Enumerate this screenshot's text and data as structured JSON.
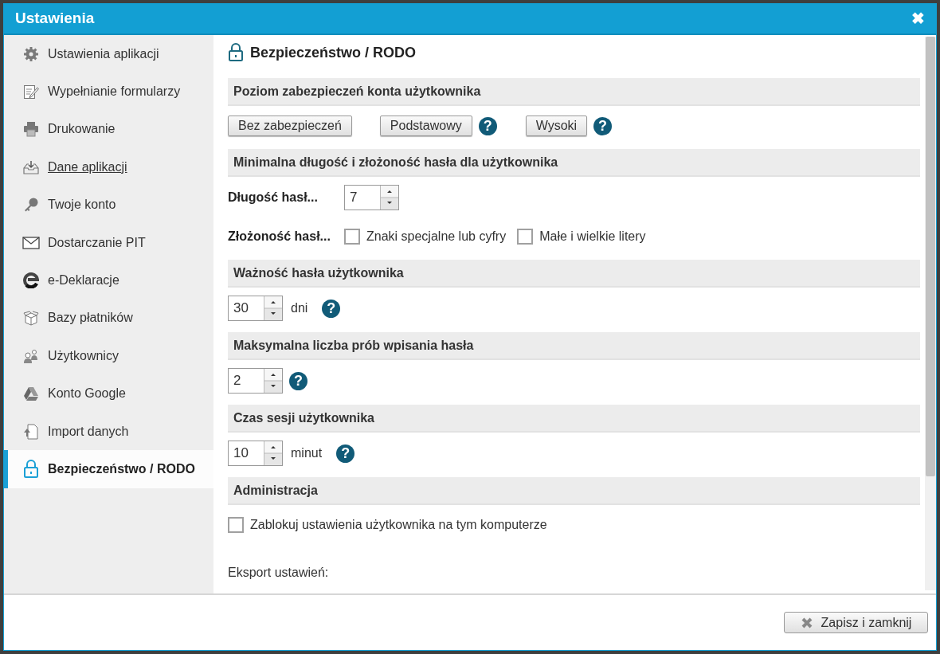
{
  "window": {
    "title": "Ustawienia",
    "close": "✖"
  },
  "sidebar": {
    "items": [
      {
        "label": "Ustawienia aplikacji",
        "selected": false,
        "hovered": false
      },
      {
        "label": "Wypełnianie formularzy",
        "selected": false,
        "hovered": false
      },
      {
        "label": "Drukowanie",
        "selected": false,
        "hovered": false
      },
      {
        "label": "Dane aplikacji",
        "selected": false,
        "hovered": true
      },
      {
        "label": "Twoje konto",
        "selected": false,
        "hovered": false
      },
      {
        "label": "Dostarczanie PIT",
        "selected": false,
        "hovered": false
      },
      {
        "label": "e-Deklaracje",
        "selected": false,
        "hovered": false
      },
      {
        "label": "Bazy płatników",
        "selected": false,
        "hovered": false
      },
      {
        "label": "Użytkownicy",
        "selected": false,
        "hovered": false
      },
      {
        "label": "Konto Google",
        "selected": false,
        "hovered": false
      },
      {
        "label": "Import danych",
        "selected": false,
        "hovered": false
      },
      {
        "label": "Bezpieczeństwo / RODO",
        "selected": true,
        "hovered": false
      }
    ]
  },
  "content": {
    "title": "Bezpieczeństwo / RODO",
    "sections": [
      {
        "heading": "Poziom zabezpieczeń konta użytkownika",
        "rows": [
          [
            {
              "kind": "button",
              "label": "Bez zabezpieczeń"
            },
            {
              "kind": "button",
              "label": "Podstawowy"
            },
            {
              "kind": "help",
              "label": "?"
            },
            {
              "kind": "button",
              "label": "Wysoki"
            },
            {
              "kind": "help",
              "label": "?"
            }
          ]
        ]
      },
      {
        "heading": "Minimalna długość i złożoność hasła dla użytkownika",
        "rows": [
          [
            {
              "kind": "label",
              "label": "Długość hasł..."
            },
            {
              "kind": "spinner",
              "value": "7"
            }
          ],
          [
            {
              "kind": "label",
              "label": "Złożoność hasł..."
            },
            {
              "kind": "checkbox",
              "label": "Znaki specjalne lub cyfry",
              "checked": false
            },
            {
              "kind": "checkbox",
              "label": "Małe i wielkie litery",
              "checked": false
            }
          ]
        ]
      },
      {
        "heading": "Ważność hasła użytkownika",
        "rows": [
          [
            {
              "kind": "spinner",
              "value": "30"
            },
            {
              "kind": "unit",
              "label": "dni"
            },
            {
              "kind": "help",
              "label": "?"
            }
          ]
        ]
      },
      {
        "heading": "Maksymalna liczba prób wpisania hasła",
        "rows": [
          [
            {
              "kind": "spinner",
              "value": "2"
            },
            {
              "kind": "help",
              "label": "?"
            }
          ]
        ]
      },
      {
        "heading": "Czas sesji użytkownika",
        "rows": [
          [
            {
              "kind": "spinner",
              "value": "10"
            },
            {
              "kind": "unit",
              "label": "minut"
            },
            {
              "kind": "help",
              "label": "?"
            }
          ]
        ]
      },
      {
        "heading": "Administracja",
        "rows": [
          [
            {
              "kind": "checkbox",
              "label": "Zablokuj ustawienia użytkownika na tym komputerze",
              "checked": false
            }
          ],
          [
            {
              "kind": "text",
              "label": "Eksport ustawień:"
            }
          ]
        ]
      }
    ]
  },
  "footer": {
    "button": "Zapisz i zamknij"
  }
}
